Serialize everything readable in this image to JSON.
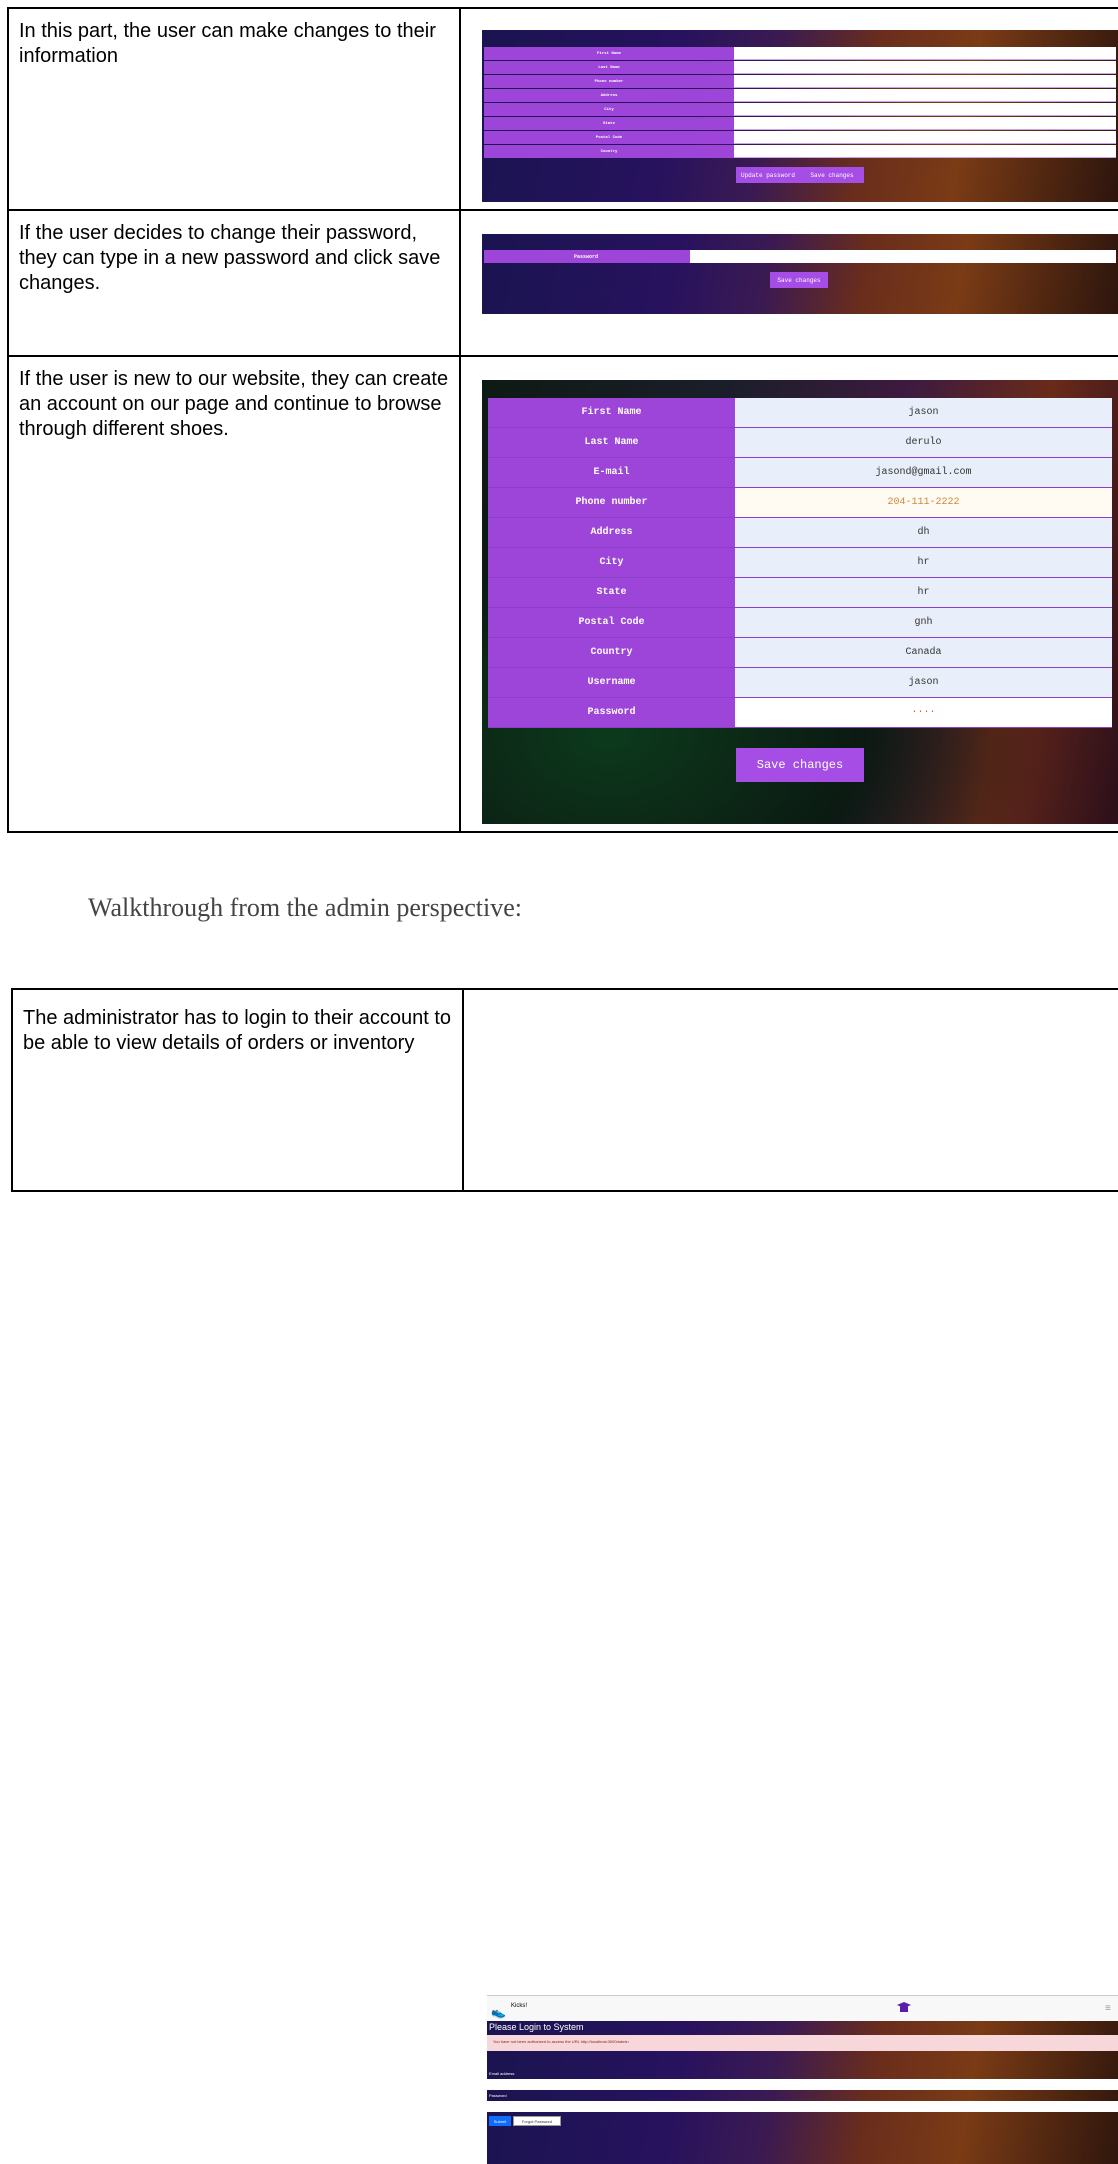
{
  "rows": [
    {
      "text": "In this part, the user can make changes to their information"
    },
    {
      "text": "If the user decides to change their password, they can type in a new password and click save changes."
    },
    {
      "text": "If the user is new to our website, they can create an account on our page and continue to browse through different shoes."
    }
  ],
  "shot1": {
    "fields": [
      "First Name",
      "Last Name",
      "Phone number",
      "Address",
      "City",
      "State",
      "Postal Code",
      "Country"
    ],
    "update_password": "Update password",
    "save_changes": "Save changes"
  },
  "shot2": {
    "field": "Password",
    "save_changes": "Save changes"
  },
  "shot3": {
    "fields": [
      {
        "label": "First Name",
        "value": "jason"
      },
      {
        "label": "Last Name",
        "value": "derulo"
      },
      {
        "label": "E-mail",
        "value": "jasond@gmail.com"
      },
      {
        "label": "Phone number",
        "value": "204-111-2222"
      },
      {
        "label": "Address",
        "value": "dh"
      },
      {
        "label": "City",
        "value": "hr"
      },
      {
        "label": "State",
        "value": "hr"
      },
      {
        "label": "Postal Code",
        "value": "gnh"
      },
      {
        "label": "Country",
        "value": "Canada"
      },
      {
        "label": "Username",
        "value": "jason"
      },
      {
        "label": "Password",
        "value": "····"
      }
    ],
    "save_changes": "Save changes"
  },
  "admin_heading": "Walkthrough from the admin perspective:",
  "admin_row": {
    "text": "The administrator has to login to their account to be able to view details of orders or inventory"
  },
  "shot4": {
    "brand": "Kicks!",
    "title": "Please Login to System",
    "alert": "You have not been authorized to access the URL http://localhost:3000/admin",
    "email_label": "Email address",
    "password_label": "Password",
    "submit": "Submit",
    "forgot": "Forgot Password"
  },
  "colors": {
    "purple": "#9d45d9",
    "button": "#a64de6",
    "alert_bg": "#f8d7da",
    "submit_blue": "#0d6efd"
  }
}
